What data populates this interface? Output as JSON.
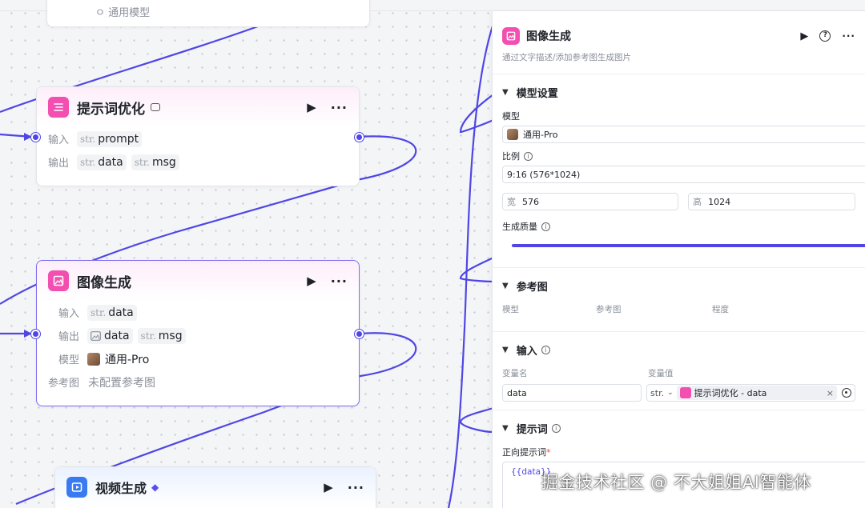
{
  "nodes": {
    "top_partial": {
      "text": "ㅇ 通用模型"
    },
    "prompt_opt": {
      "title": "提示词优化",
      "badge_icon": "link-icon",
      "input_label": "输入",
      "output_label": "输出",
      "inputs": [
        {
          "type": "str.",
          "name": "prompt"
        }
      ],
      "outputs": [
        {
          "type": "str.",
          "name": "data"
        },
        {
          "type": "str.",
          "name": "msg"
        }
      ]
    },
    "image_gen": {
      "title": "图像生成",
      "input_label": "输入",
      "output_label": "输出",
      "model_label": "模型",
      "model_value": "通用-Pro",
      "ref_label": "参考图",
      "ref_value": "未配置参考图",
      "inputs": [
        {
          "type": "str.",
          "name": "data"
        }
      ],
      "outputs": [
        {
          "type": "image-icon",
          "name": "data"
        },
        {
          "type": "str.",
          "name": "msg"
        }
      ]
    },
    "video_gen": {
      "title": "视频生成",
      "badge_icon": "diamond-icon"
    }
  },
  "panel": {
    "title": "图像生成",
    "subtitle": "通过文字描述/添加参考图生成图片",
    "model_section": {
      "title": "模型设置",
      "model_label": "模型",
      "model_value": "通用-Pro",
      "ratio_label": "比例",
      "ratio_value": "9:16 (576*1024)",
      "width_label": "宽",
      "width_value": "576",
      "height_label": "高",
      "height_value": "1024",
      "quality_label": "生成质量",
      "quality_fraction": 1.0
    },
    "ref_section": {
      "title": "参考图",
      "cols": [
        "模型",
        "参考图",
        "程度"
      ]
    },
    "input_section": {
      "title": "输入",
      "var_name_label": "变量名",
      "var_value_label": "变量值",
      "var_name": "data",
      "var_type": "str.",
      "var_ref": "提示词优化 - data"
    },
    "prompt_section": {
      "title": "提示词",
      "positive_label": "正向提示词",
      "required_mark": "*",
      "positive_value": "{{data}}"
    }
  },
  "watermark": "掘金技术社区 @ 不大姐姐AI智能体",
  "colors": {
    "accent": "#4f46e5",
    "node_pink": "#f24fb0",
    "node_blue": "#3a7af0",
    "selected_border": "#7b6cf0"
  }
}
